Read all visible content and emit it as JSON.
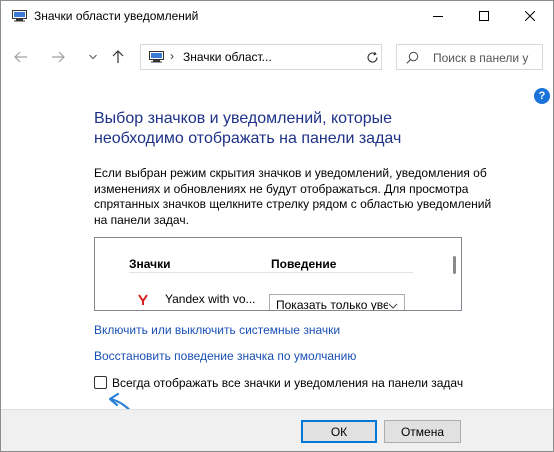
{
  "window": {
    "title": "Значки области уведомлений"
  },
  "address": {
    "separator": "›",
    "path": "Значки област..."
  },
  "search": {
    "placeholder": "Поиск в панели у"
  },
  "help": {
    "label": "?"
  },
  "content": {
    "heading": "Выбор значков и уведомлений, которые необходимо отображать на панели задач",
    "description": "Если выбран режим скрытия значков и уведомлений, уведомления об изменениях и обновлениях не будут отображаться. Для просмотра спрятанных значков щелкните стрелку рядом с областью уведомлений на панели задач."
  },
  "table": {
    "columns": [
      "Значки",
      "Поведение"
    ],
    "rows": [
      {
        "icon": "yandex-icon",
        "name": "Yandex with vo...",
        "behavior": "Показать только уве"
      }
    ]
  },
  "links": {
    "system_icons": "Включить или выключить системные значки",
    "restore_default": "Восстановить поведение значка по умолчанию"
  },
  "checkbox": {
    "label": "Всегда отображать все значки и уведомления на панели задач",
    "checked": false
  },
  "buttons": {
    "ok": "ОК",
    "cancel": "Отмена"
  },
  "colors": {
    "heading": "#1e3287",
    "link": "#1a50b4",
    "accent": "#0078d7",
    "annotation_arrow": "#2c7fd6"
  }
}
